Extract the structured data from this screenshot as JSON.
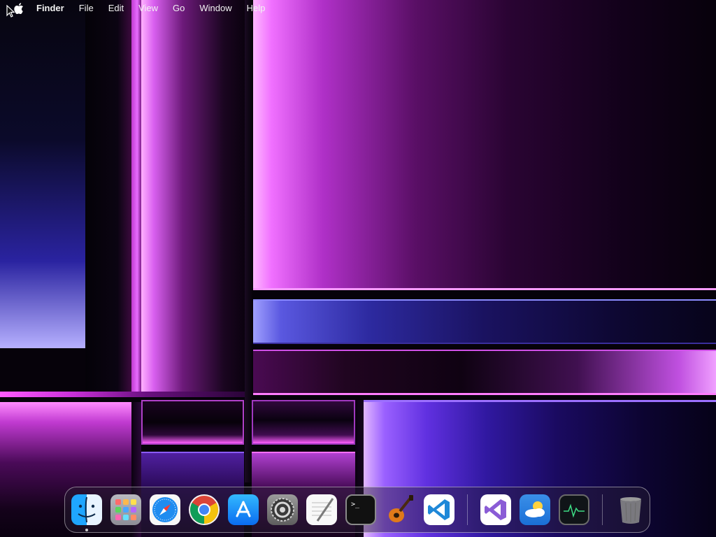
{
  "menubar": {
    "apple_icon": "apple-logo-icon",
    "app_name": "Finder",
    "items": [
      "File",
      "Edit",
      "View",
      "Go",
      "Window",
      "Help"
    ]
  },
  "dock": {
    "apps": [
      {
        "name": "Finder",
        "icon": "finder-icon",
        "running": true
      },
      {
        "name": "Launchpad",
        "icon": "launchpad-icon",
        "running": false
      },
      {
        "name": "Safari",
        "icon": "safari-icon",
        "running": false
      },
      {
        "name": "Google Chrome",
        "icon": "chrome-icon",
        "running": false
      },
      {
        "name": "App Store",
        "icon": "app-store-icon",
        "running": false
      },
      {
        "name": "System Preferences",
        "icon": "settings-gear-icon",
        "running": false
      },
      {
        "name": "TextEdit",
        "icon": "textedit-icon",
        "running": false
      },
      {
        "name": "Terminal",
        "icon": "terminal-icon",
        "running": false
      },
      {
        "name": "GarageBand",
        "icon": "garageband-guitar-icon",
        "running": false
      },
      {
        "name": "Visual Studio Code",
        "icon": "vscode-icon",
        "running": false
      }
    ],
    "recent_apps": [
      {
        "name": "Visual Studio",
        "icon": "visual-studio-icon"
      },
      {
        "name": "Weather",
        "icon": "weather-icon"
      },
      {
        "name": "Activity Monitor",
        "icon": "activity-monitor-icon"
      }
    ],
    "trash": {
      "name": "Trash",
      "icon": "trash-icon"
    }
  },
  "terminal_prompt": ">_",
  "colors": {
    "wallpaper_magenta": "#f070ff",
    "wallpaper_violet": "#6030e0",
    "wallpaper_dark": "#06020a"
  }
}
